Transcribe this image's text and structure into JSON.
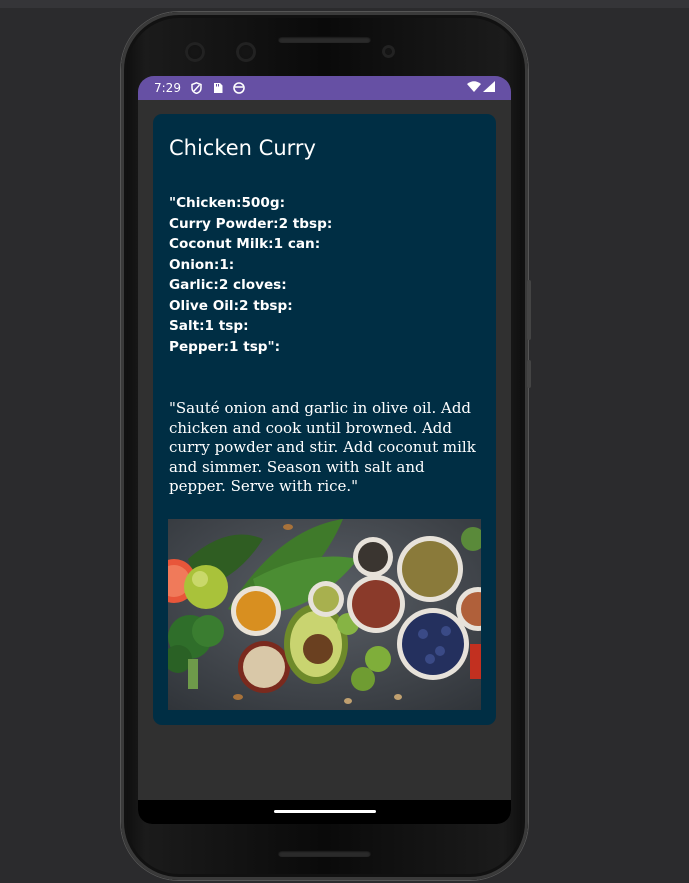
{
  "status_bar": {
    "time": "7:29",
    "icons": [
      "shield-icon",
      "sd-card-icon",
      "face-icon"
    ],
    "right_icons": [
      "wifi-icon",
      "signal-icon"
    ],
    "color": "#6650a4"
  },
  "recipe": {
    "title": "Chicken Curry",
    "ingredients": [
      "\"Chicken:500g:",
      "Curry Powder:2 tbsp:",
      "Coconut Milk:1 can:",
      "Onion:1:",
      "Garlic:2 cloves:",
      "Olive Oil:2 tbsp:",
      "Salt:1 tsp:",
      "Pepper:1 tsp\":"
    ],
    "instructions": "\"Sauté onion and garlic in olive oil. Add chicken and cook until browned. Add curry powder and stir. Add coconut milk and simmer. Season with salt and pepper. Serve with rice.\"",
    "card_color": "#002e44"
  }
}
